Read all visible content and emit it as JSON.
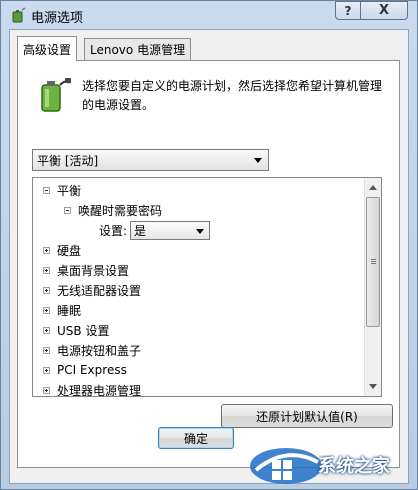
{
  "window": {
    "title": "电源选项",
    "help_label": "?",
    "close_label": "X"
  },
  "tabs": [
    {
      "label": "高级设置",
      "active": true
    },
    {
      "label": "Lenovo 电源管理",
      "active": false
    }
  ],
  "description": "选择您要自定义的电源计划，然后选择您希望计算机管理的电源设置。",
  "plan_select": {
    "value": "平衡 [活动]"
  },
  "tree": {
    "root": "平衡",
    "child": "唤醒时需要密码",
    "setting_label": "设置:",
    "setting_value": "是",
    "items": [
      "硬盘",
      "桌面背景设置",
      "无线适配器设置",
      "睡眠",
      "USB 设置",
      "电源按钮和盖子",
      "PCI Express",
      "处理器电源管理"
    ]
  },
  "buttons": {
    "restore": "还原计划默认值(R)",
    "ok": "确定"
  },
  "watermark": {
    "text": "系统之家"
  },
  "colors": {
    "accent": "#3c7fb1",
    "frame": "#b7cde4"
  }
}
